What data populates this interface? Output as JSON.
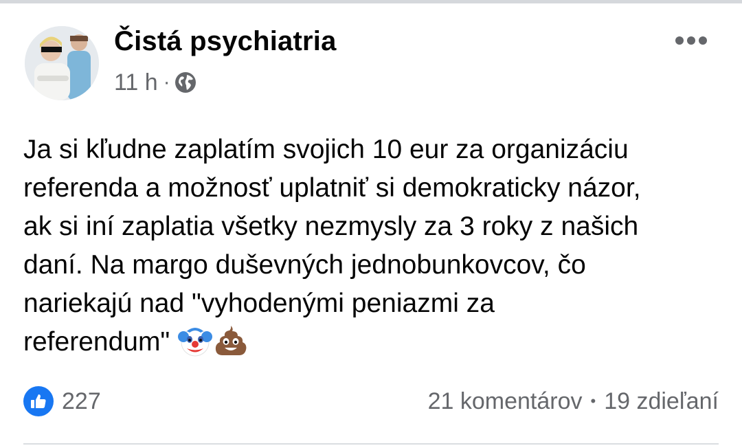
{
  "post": {
    "author": "Čistá psychiatria",
    "time": "11 h",
    "meta_separator": "·",
    "audience_icon": "globe-icon",
    "more_icon": "more-options-icon",
    "text_lines": [
      "Ja si kľudne zaplatím svojich 10 eur za organizáciu",
      "referenda a možnosť uplatniť si demokraticky názor,",
      "ak si iní zaplatia všetky nezmysly za 3 roky z našich",
      "daní. Na margo duševných jednobunkovcov, čo",
      "nariekajú nad \"vyhodenými peniazmi za",
      "referendum\""
    ],
    "emojis": [
      "clown-face-emoji",
      "pile-of-poo-emoji"
    ]
  },
  "footer": {
    "reaction_icon": "like-icon",
    "reaction_count": "227",
    "comments": "21 komentárov",
    "stats_separator": "•",
    "shares": "19 zdieľaní"
  },
  "colors": {
    "accent": "#1877f2",
    "secondary_text": "#65676b",
    "primary_text": "#050505"
  }
}
